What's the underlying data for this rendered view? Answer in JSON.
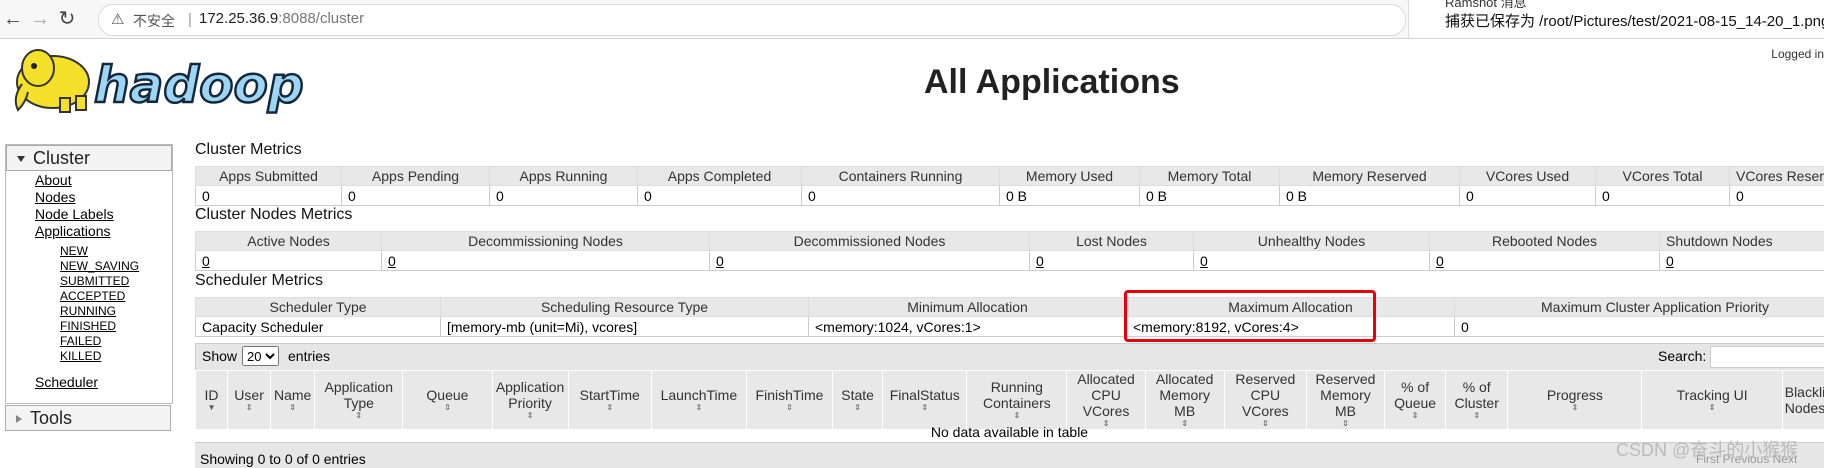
{
  "browser": {
    "security_label": "不安全",
    "url_host": "172.25.36.9",
    "url_path": ":8088/cluster",
    "download_clip": "Ramshot 消息",
    "download_message": "捕获已保存为 /root/Pictures/test/2021-08-15_14-20_1.png"
  },
  "header": {
    "logo_text": "hadoop",
    "page_title": "All Applications",
    "logged_in": "Logged in"
  },
  "sidebar": {
    "cluster_label": "Cluster",
    "links": [
      "About",
      "Nodes",
      "Node Labels",
      "Applications"
    ],
    "app_states": [
      "NEW",
      "NEW_SAVING",
      "SUBMITTED",
      "ACCEPTED",
      "RUNNING",
      "FINISHED",
      "FAILED",
      "KILLED"
    ],
    "scheduler_label": "Scheduler",
    "tools_label": "Tools"
  },
  "cluster_metrics": {
    "title": "Cluster Metrics",
    "headers": [
      "Apps Submitted",
      "Apps Pending",
      "Apps Running",
      "Apps Completed",
      "Containers Running",
      "Memory Used",
      "Memory Total",
      "Memory Reserved",
      "VCores Used",
      "VCores Total",
      "VCores Reserved"
    ],
    "values": [
      "0",
      "0",
      "0",
      "0",
      "0",
      "0 B",
      "0 B",
      "0 B",
      "0",
      "0",
      "0"
    ]
  },
  "cluster_nodes_metrics": {
    "title": "Cluster Nodes Metrics",
    "headers": [
      "Active Nodes",
      "Decommissioning Nodes",
      "Decommissioned Nodes",
      "Lost Nodes",
      "Unhealthy Nodes",
      "Rebooted Nodes",
      "Shutdown Nodes"
    ],
    "values": [
      "0",
      "0",
      "0",
      "0",
      "0",
      "0",
      "0"
    ]
  },
  "scheduler_metrics": {
    "title": "Scheduler Metrics",
    "headers": [
      "Scheduler Type",
      "Scheduling Resource Type",
      "Minimum Allocation",
      "Maximum Allocation",
      "Maximum Cluster Application Priority"
    ],
    "values": [
      "Capacity Scheduler",
      "[memory-mb (unit=Mi), vcores]",
      "<memory:1024, vCores:1>",
      "<memory:8192, vCores:4>",
      "0"
    ]
  },
  "apps_table": {
    "show_label": "Show",
    "page_size": "20",
    "entries_label": "entries",
    "search_label": "Search:",
    "headers": [
      "ID",
      "User",
      "Name",
      "Application Type",
      "Queue",
      "Application Priority",
      "StartTime",
      "LaunchTime",
      "FinishTime",
      "State",
      "FinalStatus",
      "Running Containers",
      "Allocated CPU VCores",
      "Allocated Memory MB",
      "Reserved CPU VCores",
      "Reserved Memory MB",
      "% of Queue",
      "% of Cluster",
      "Progress",
      "Tracking UI",
      "Blacklisted Nodes"
    ],
    "empty_message": "No data available in table",
    "info": "Showing 0 to 0 of 0 entries",
    "pager": "First   Previous   Next"
  },
  "watermark": "CSDN @奋斗的小猴猴",
  "colors": {
    "highlight_box": "#e8000b",
    "header_bg": "#e8e8e8",
    "logo_yellow": "#f5e02a",
    "logo_blue": "#9dd5f5"
  }
}
